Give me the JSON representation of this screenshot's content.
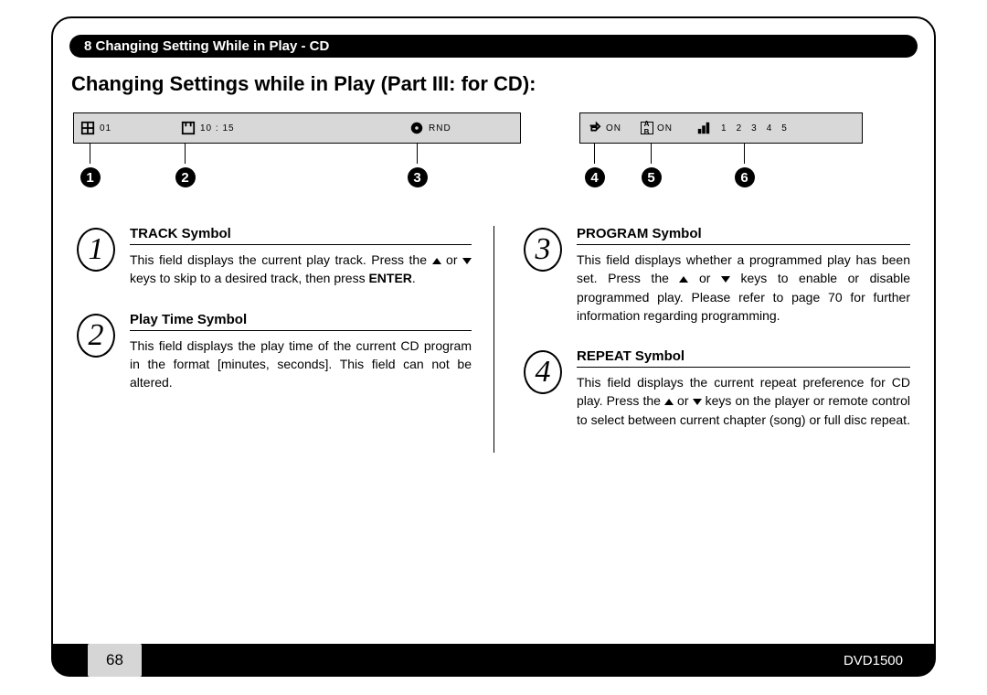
{
  "chapter_bar": "8 Changing Setting While in Play - CD",
  "heading": "Changing Settings while in Play (Part III: for CD):",
  "lcd_left": {
    "track_value": "01",
    "time_value": "10 : 15",
    "mode_value": "RND"
  },
  "lcd_right": {
    "repeat_value": "ON",
    "ab_value": "ON",
    "program_values": [
      "1",
      "2",
      "3",
      "4",
      "5"
    ]
  },
  "callouts_left": [
    "1",
    "2",
    "3"
  ],
  "callouts_right": [
    "4",
    "5",
    "6"
  ],
  "items": {
    "i1": {
      "num": "1",
      "title": "TRACK Symbol",
      "text_a": "This field displays the current play track. Press the ",
      "text_b": " or ",
      "text_c": " keys to skip to a desired track, then press ",
      "enter": "ENTER",
      "text_d": "."
    },
    "i2": {
      "num": "2",
      "title": "Play Time Symbol",
      "text": "This field displays the play time of the current CD program in the format [minutes, seconds]. This field can not be altered."
    },
    "i3": {
      "num": "3",
      "title": "PROGRAM Symbol",
      "text_a": "This field displays whether a programmed play has been set. Press the ",
      "text_b": " or ",
      "text_c": " keys to enable or disable programmed play. Please refer to page 70 for further information regarding programming."
    },
    "i4": {
      "num": "4",
      "title": "REPEAT Symbol",
      "text_a": "This field displays the current repeat preference for CD play. Press the ",
      "text_b": " or ",
      "text_c": " keys on the player or remote control to select between current chapter (song) or full disc repeat."
    }
  },
  "footer": {
    "page": "68",
    "model": "DVD1500"
  }
}
